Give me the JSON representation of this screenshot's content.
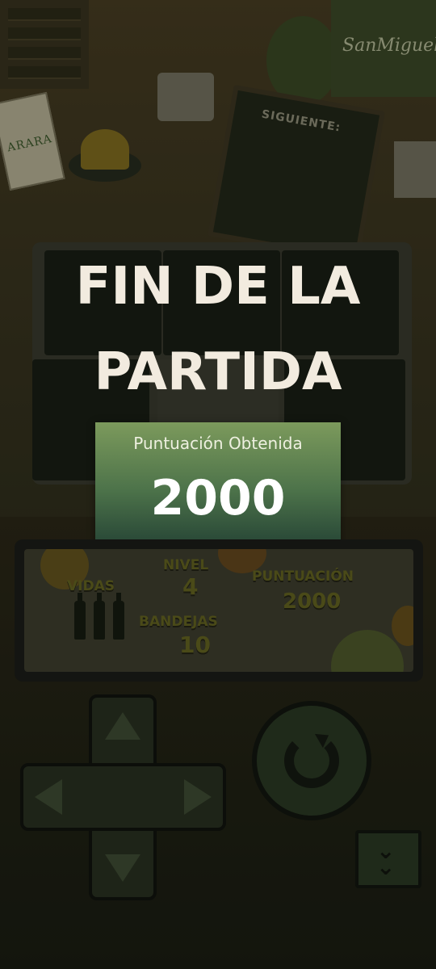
{
  "scene": {
    "sign_arara": "ARARA",
    "sign_sanmiguel": "SanMiguel",
    "board_next": "SIGUIENTE:"
  },
  "game_over": {
    "title_line1": "FIN DE LA",
    "title_line2": "PARTIDA",
    "score_label": "Puntuación Obtenida",
    "score_value": "2000"
  },
  "hud": {
    "lives_label": "VIDAS",
    "lives_count": 3,
    "level_label": "NIVEL",
    "level_value": "4",
    "trays_label": "BANDEJAS",
    "trays_value": "10",
    "score_label": "PUNTUACIÓN",
    "score_value": "2000"
  },
  "controls": {
    "up": "up-arrow-icon",
    "down": "down-arrow-icon",
    "left": "left-arrow-icon",
    "right": "right-arrow-icon",
    "rotate": "rotate-icon",
    "drop": "double-chevron-down-icon"
  },
  "colors": {
    "title": "#f2ebdf",
    "score_card_top": "#7c9a5c",
    "score_card_bottom": "#274636",
    "hud_text": "#4a4a18"
  }
}
